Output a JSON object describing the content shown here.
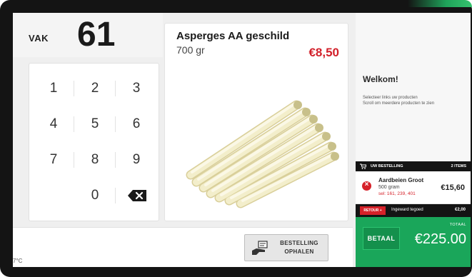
{
  "vak": {
    "label": "VAK",
    "number": "61"
  },
  "keypad": {
    "keys": [
      "1",
      "2",
      "3",
      "4",
      "5",
      "6",
      "7",
      "8",
      "9",
      "0"
    ],
    "backspace_icon": "backspace-icon"
  },
  "product": {
    "name": "Asperges AA geschild",
    "weight": "700 gr",
    "price": "€8,50",
    "image": "white-asparagus-bundle"
  },
  "bottom": {
    "temperature": "7°C",
    "ophalen_line1": "BESTELLING",
    "ophalen_line2": "OPHALEN"
  },
  "side": {
    "welcome": "Welkom!",
    "hint_line1": "Selecteer links uw producten",
    "hint_line2": "Scroll om meerdere producten te zien"
  },
  "order": {
    "header_label": "UW BESTELLING",
    "item_count": "2 ITEMS",
    "items": [
      {
        "name": "Aardbeien Groot",
        "qty": "500 gram",
        "sel": "sel: 161, 239, 401",
        "price": "€15,60"
      }
    ],
    "retour_label": "RETOUR +",
    "tegoed_label": "Ingeward tegoed",
    "tegoed_value": "€2,00",
    "betaal_label": "BETAAL",
    "totaal_label": "TOTAAL",
    "totaal_value": "€225.00"
  },
  "colors": {
    "accent_green": "#1aa65a",
    "price_red": "#d2202a",
    "bezel": "#141414"
  }
}
